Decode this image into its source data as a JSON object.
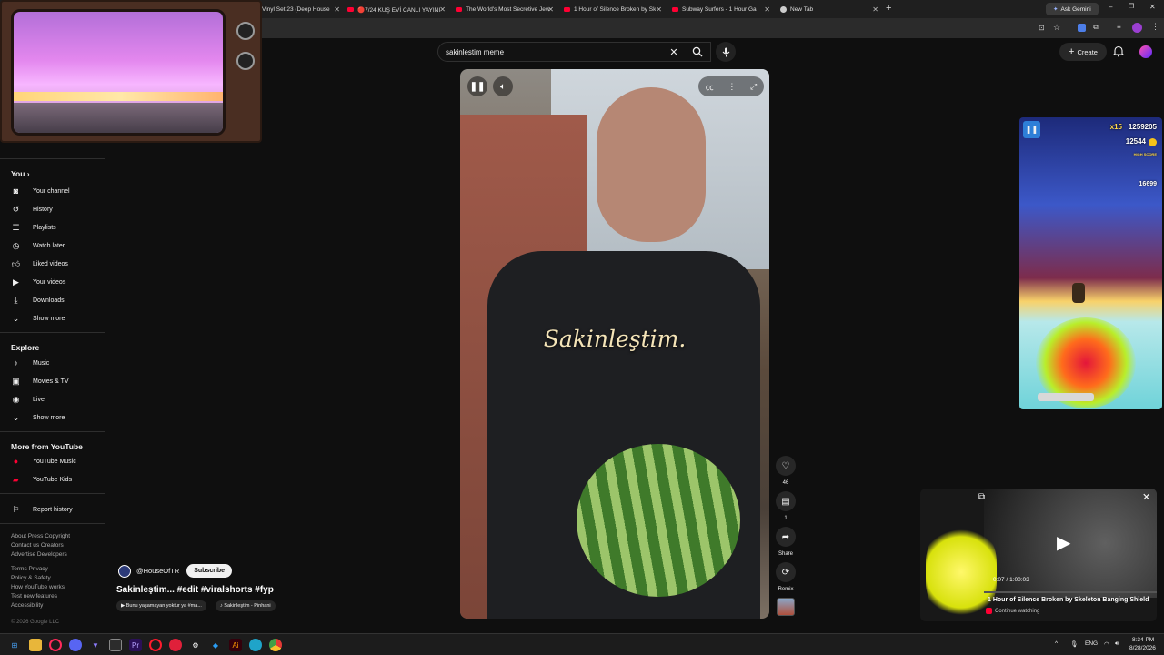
{
  "browser": {
    "tabs": [
      {
        "label": "Vinyl Set 23 (Deep House"
      },
      {
        "label": "🔴7/24 KUŞ EVİ CANLI YAYINI"
      },
      {
        "label": "The World's Most Secretive Jew"
      },
      {
        "label": "1 Hour of Silence Broken by Sk"
      },
      {
        "label": "Subway Surfers - 1 Hour Ga"
      },
      {
        "label": "New Tab"
      }
    ],
    "new_tab": "+",
    "ask_gemini": "Ask Gemini",
    "colors": {
      "tab_bg": "#1f1f1f",
      "yt_red": "#ff0033"
    }
  },
  "youtube": {
    "search": {
      "value": "sakinlestim meme"
    },
    "create_label": "Create"
  },
  "sidebar": {
    "you_heading": "You",
    "you_items": [
      {
        "label": "Your channel",
        "icon": "channel-icon"
      },
      {
        "label": "History",
        "icon": "history-icon"
      },
      {
        "label": "Playlists",
        "icon": "playlist-icon"
      },
      {
        "label": "Watch later",
        "icon": "clock-icon"
      },
      {
        "label": "Liked videos",
        "icon": "thumb-up-icon"
      },
      {
        "label": "Your videos",
        "icon": "video-icon"
      },
      {
        "label": "Downloads",
        "icon": "download-icon"
      },
      {
        "label": "Show more",
        "icon": "chevron-down-icon"
      }
    ],
    "explore_heading": "Explore",
    "explore_items": [
      {
        "label": "Music",
        "icon": "music-icon"
      },
      {
        "label": "Movies & TV",
        "icon": "movie-icon"
      },
      {
        "label": "Live",
        "icon": "live-icon"
      },
      {
        "label": "Show more",
        "icon": "chevron-down-icon"
      }
    ],
    "more_heading": "More from YouTube",
    "more_items": [
      {
        "label": "YouTube Music",
        "icon": "youtube-music-icon"
      },
      {
        "label": "YouTube Kids",
        "icon": "youtube-kids-icon"
      }
    ],
    "report": "Report history",
    "footer1": "About  Press  Copyright",
    "footer2": "Contact us  Creators",
    "footer3": "Advertise  Developers",
    "footer4": "Terms  Privacy",
    "footer5": "Policy & Safety",
    "footer6": "How YouTube works",
    "footer7": "Test new features",
    "footer8": "Accessibility",
    "copyright": "© 2026 Google LLC"
  },
  "short": {
    "caption": "Sakinleştim.",
    "channel": "@HouseOfTR",
    "subscribe": "Subscribe",
    "title": "Sakinleştim... #edit  #viralshorts #fyp",
    "chip1": "▶ Bunu yaşamayan yoktur ya #ma...",
    "chip2": "♪ Sakinleştim - Pinhani",
    "like_count": "46",
    "comment_count": "1",
    "share_label": "Share",
    "remix_label": "Remix"
  },
  "game": {
    "multiplier": "x15",
    "score": "1259205",
    "coins": "12544",
    "high_score_label": "HIGH SCORE",
    "high_score": "16699"
  },
  "miniplayer": {
    "time": "0:07 / 1:00:03",
    "title": "1 Hour of Silence Broken by Skeleton Banging Shield",
    "continue": "Continue watching"
  },
  "taskbar": {
    "lang": "ENG",
    "time": "8:34 PM",
    "date": "8/28/2026"
  }
}
